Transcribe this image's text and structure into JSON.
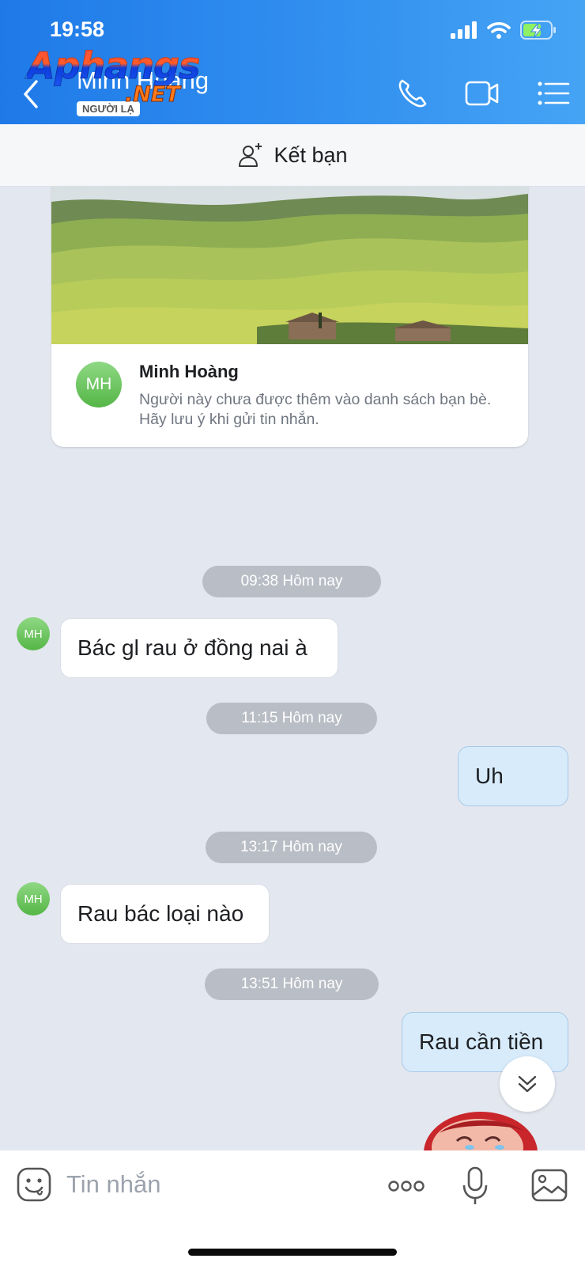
{
  "status_bar": {
    "time": "19:58"
  },
  "header": {
    "contact_name": "Minh Hoàng",
    "badge": "NGƯỜI LẠ",
    "watermark": "Aphangs",
    "watermark_suffix": ".NET"
  },
  "friend_bar": {
    "label": "Kết bạn"
  },
  "profile_card": {
    "avatar_initials": "MH",
    "name": "Minh Hoàng",
    "note": "Người này chưa được thêm vào danh sách bạn bè. Hãy lưu ý khi gửi tin nhắn."
  },
  "messages": [
    {
      "time": "09:38 Hôm nay",
      "direction": "incoming",
      "avatar": "MH",
      "text": "Bác gl rau ở đồng nai à"
    },
    {
      "time": "11:15 Hôm nay",
      "direction": "outgoing",
      "text": "Uh"
    },
    {
      "time": "13:17 Hôm nay",
      "direction": "incoming",
      "avatar": "MH",
      "text": "Rau bác loại nào"
    },
    {
      "time": "13:51 Hôm nay",
      "direction": "outgoing",
      "text": "Rau cần tiền"
    }
  ],
  "composer": {
    "placeholder": "Tin nhắn"
  },
  "colors": {
    "header_start": "#1f7ae8",
    "header_end": "#46a4f5",
    "outgoing_bubble": "#d7ebfb",
    "incoming_bubble": "#ffffff",
    "avatar_green": "#6cc45c",
    "chat_background": "#e3e7ef"
  },
  "icons": [
    "back-chevron-icon",
    "phone-icon",
    "video-camera-icon",
    "list-menu-icon",
    "add-friend-icon",
    "double-chevron-down-icon",
    "emoji-icon",
    "more-dots-icon",
    "microphone-icon",
    "image-icon",
    "signal-icon",
    "wifi-icon",
    "battery-charging-icon"
  ]
}
